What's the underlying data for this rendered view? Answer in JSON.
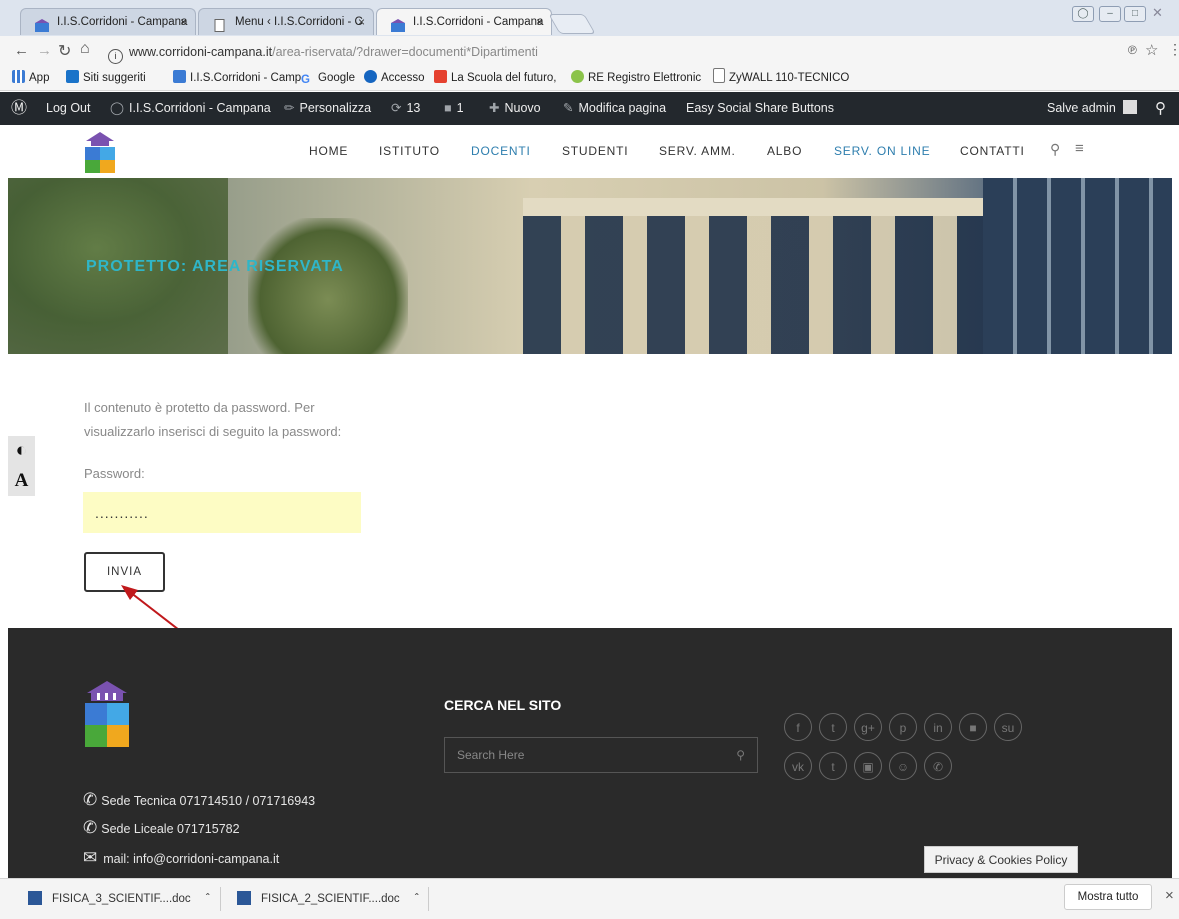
{
  "browser": {
    "tabs": [
      {
        "label": "I.I.S.Corridoni - Campana",
        "close": "×"
      },
      {
        "label": "Menu ‹ I.I.S.Corridoni - C",
        "close": "×"
      },
      {
        "label": "I.I.S.Corridoni - Campana",
        "close": "×"
      }
    ],
    "url_domain": "www.corridoni-campana.it",
    "url_path": "/area-riservata/?drawer=documenti*Dipartimenti",
    "bookmarks": [
      "App",
      "Siti suggeriti",
      "I.I.S.Corridoni - Camp",
      "Google",
      "Accesso",
      "La Scuola del futuro,",
      "RE Registro Elettronic",
      "ZyWALL 110-TECNICO"
    ]
  },
  "adminbar": {
    "items": [
      "Log Out",
      "I.I.S.Corridoni - Campana",
      "Personalizza",
      "13",
      "1",
      "Nuovo",
      "Modifica pagina",
      "Easy Social Share Buttons"
    ],
    "greeting": "Salve admin"
  },
  "nav": [
    "HOME",
    "ISTITUTO",
    "DOCENTI",
    "STUDENTI",
    "SERV. AMM.",
    "ALBO",
    "SERV. ON LINE",
    "CONTATTI"
  ],
  "hero": {
    "title": "PROTETTO: AREA RISERVATA"
  },
  "content": {
    "message_line1": "Il contenuto è protetto da password. Per",
    "message_line2": "visualizzarlo inserisci di seguito la password:",
    "password_label": "Password:",
    "password_value": "...........",
    "submit_label": "INVIA"
  },
  "footer": {
    "search_title": "CERCA NEL SITO",
    "search_placeholder": "Search Here",
    "contacts": [
      "Sede Tecnica  071714510 / 071716943",
      "Sede Liceale 071715782",
      "mail: info@corridoni-campana.it"
    ],
    "social_icons": [
      "facebook-icon",
      "twitter-icon",
      "googleplus-icon",
      "pinterest-icon",
      "linkedin-icon",
      "delicious-icon",
      "stumbleupon-icon",
      "vk-icon",
      "tumblr-icon",
      "digg-icon",
      "reddit-icon",
      "whatsapp-icon"
    ],
    "privacy": "Privacy & Cookies Policy"
  },
  "downloads": {
    "files": [
      "FISICA_3_SCIENTIF....doc",
      "FISICA_2_SCIENTIF....doc"
    ],
    "show_all": "Mostra tutto",
    "close": "×"
  },
  "colors": {
    "admin_bar": "#23282d",
    "nav_accent": "#2e7eae",
    "hero_title": "#2fb6c8",
    "footer_bg": "#2a2a2a",
    "password_bg": "#fdfcc4",
    "arrow": "#c0181b"
  }
}
